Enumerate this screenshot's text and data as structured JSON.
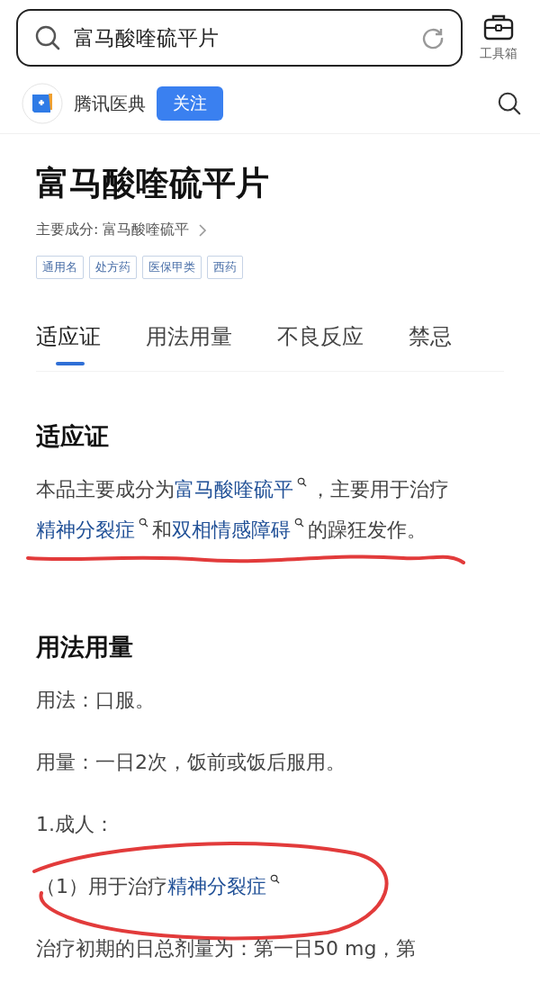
{
  "search": {
    "value": "富马酸喹硫平片"
  },
  "toolbox": {
    "label": "工具箱"
  },
  "source": {
    "name": "腾讯医典",
    "follow_button": "关注"
  },
  "drug": {
    "title": "富马酸喹硫平片",
    "ingredient": "主要成分: 富马酸喹硫平",
    "tags": [
      "通用名",
      "处方药",
      "医保甲类",
      "西药"
    ]
  },
  "tabs": [
    {
      "label": "适应证",
      "selected": true
    },
    {
      "label": "用法用量",
      "selected": false
    },
    {
      "label": "不良反应",
      "selected": false
    },
    {
      "label": "禁忌",
      "selected": false
    }
  ],
  "sections": [
    {
      "heading": "适应证",
      "paragraphs": [
        {
          "underlined": true,
          "segments": [
            {
              "text": "本品主要成分为",
              "link": false
            },
            {
              "text": "富马酸喹硫平",
              "link": true
            },
            {
              "text": "，主要用于治疗",
              "link": false
            },
            {
              "text": "精神分裂症",
              "link": true
            },
            {
              "text": "和",
              "link": false
            },
            {
              "text": "双相情感障碍",
              "link": true
            },
            {
              "text": "的躁狂发作。",
              "link": false
            }
          ]
        }
      ]
    },
    {
      "heading": "用法用量",
      "paragraphs": [
        {
          "segments": [
            {
              "text": "用法：口服。",
              "link": false
            }
          ]
        },
        {
          "segments": [
            {
              "text": "用量：一日2次，饭前或饭后服用。",
              "link": false
            }
          ]
        },
        {
          "segments": [
            {
              "text": "1.成人：",
              "link": false
            }
          ]
        },
        {
          "circled": true,
          "segments": [
            {
              "text": "（1）用于治疗",
              "link": false
            },
            {
              "text": "精神分裂症",
              "link": true
            }
          ]
        },
        {
          "segments": [
            {
              "text": "治疗初期的日总剂量为：第一日50 mg，第",
              "link": false
            }
          ]
        }
      ]
    }
  ]
}
